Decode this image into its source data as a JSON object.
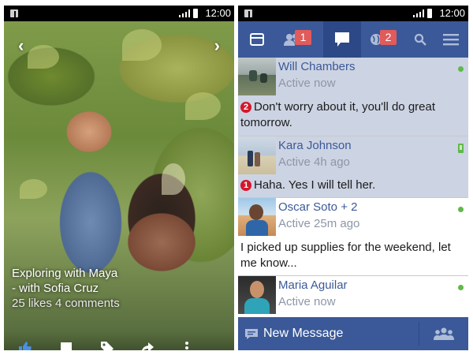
{
  "status_bar": {
    "time": "12:00"
  },
  "photo_viewer": {
    "caption_title": "Exploring with Maya",
    "caption_with": "- with Sofia Cruz",
    "likes_comments": "25 likes 4 comments",
    "actions": [
      "like-icon",
      "comment-icon",
      "tag-icon",
      "share-icon",
      "more-icon"
    ]
  },
  "messages_app": {
    "nav_tabs": [
      {
        "icon": "feed-icon",
        "badge": ""
      },
      {
        "icon": "friends-icon",
        "badge": "1"
      },
      {
        "icon": "messages-icon",
        "badge": ""
      },
      {
        "icon": "globe-icon",
        "badge": "2"
      },
      {
        "icon": "search-icon",
        "badge": ""
      },
      {
        "icon": "menu-icon",
        "badge": ""
      }
    ],
    "active_tab": "messages-icon",
    "conversations": [
      {
        "name": "Will Chambers",
        "status": "Active now",
        "unread_count": "2",
        "preview": "Don't worry about it, you'll do great tomorrow.",
        "presence": "online"
      },
      {
        "name": "Kara Johnson",
        "status": "Active 4h ago",
        "unread_count": "1",
        "preview": "Haha. Yes I will tell her.",
        "presence": "mobile"
      },
      {
        "name": "Oscar Soto + 2",
        "status": "Active 25m ago",
        "unread_count": "",
        "preview": "I picked up supplies for the weekend, let me know...",
        "presence": "online"
      },
      {
        "name": "Maria Aguilar",
        "status": "Active now",
        "unread_count": "",
        "preview": "",
        "presence": "online"
      }
    ],
    "new_message_label": "New Message"
  },
  "colors": {
    "fb_blue": "#3b5998",
    "unread_bg": "#ccd3e2",
    "badge_red": "#e15b5b",
    "online_green": "#5fb94a"
  }
}
